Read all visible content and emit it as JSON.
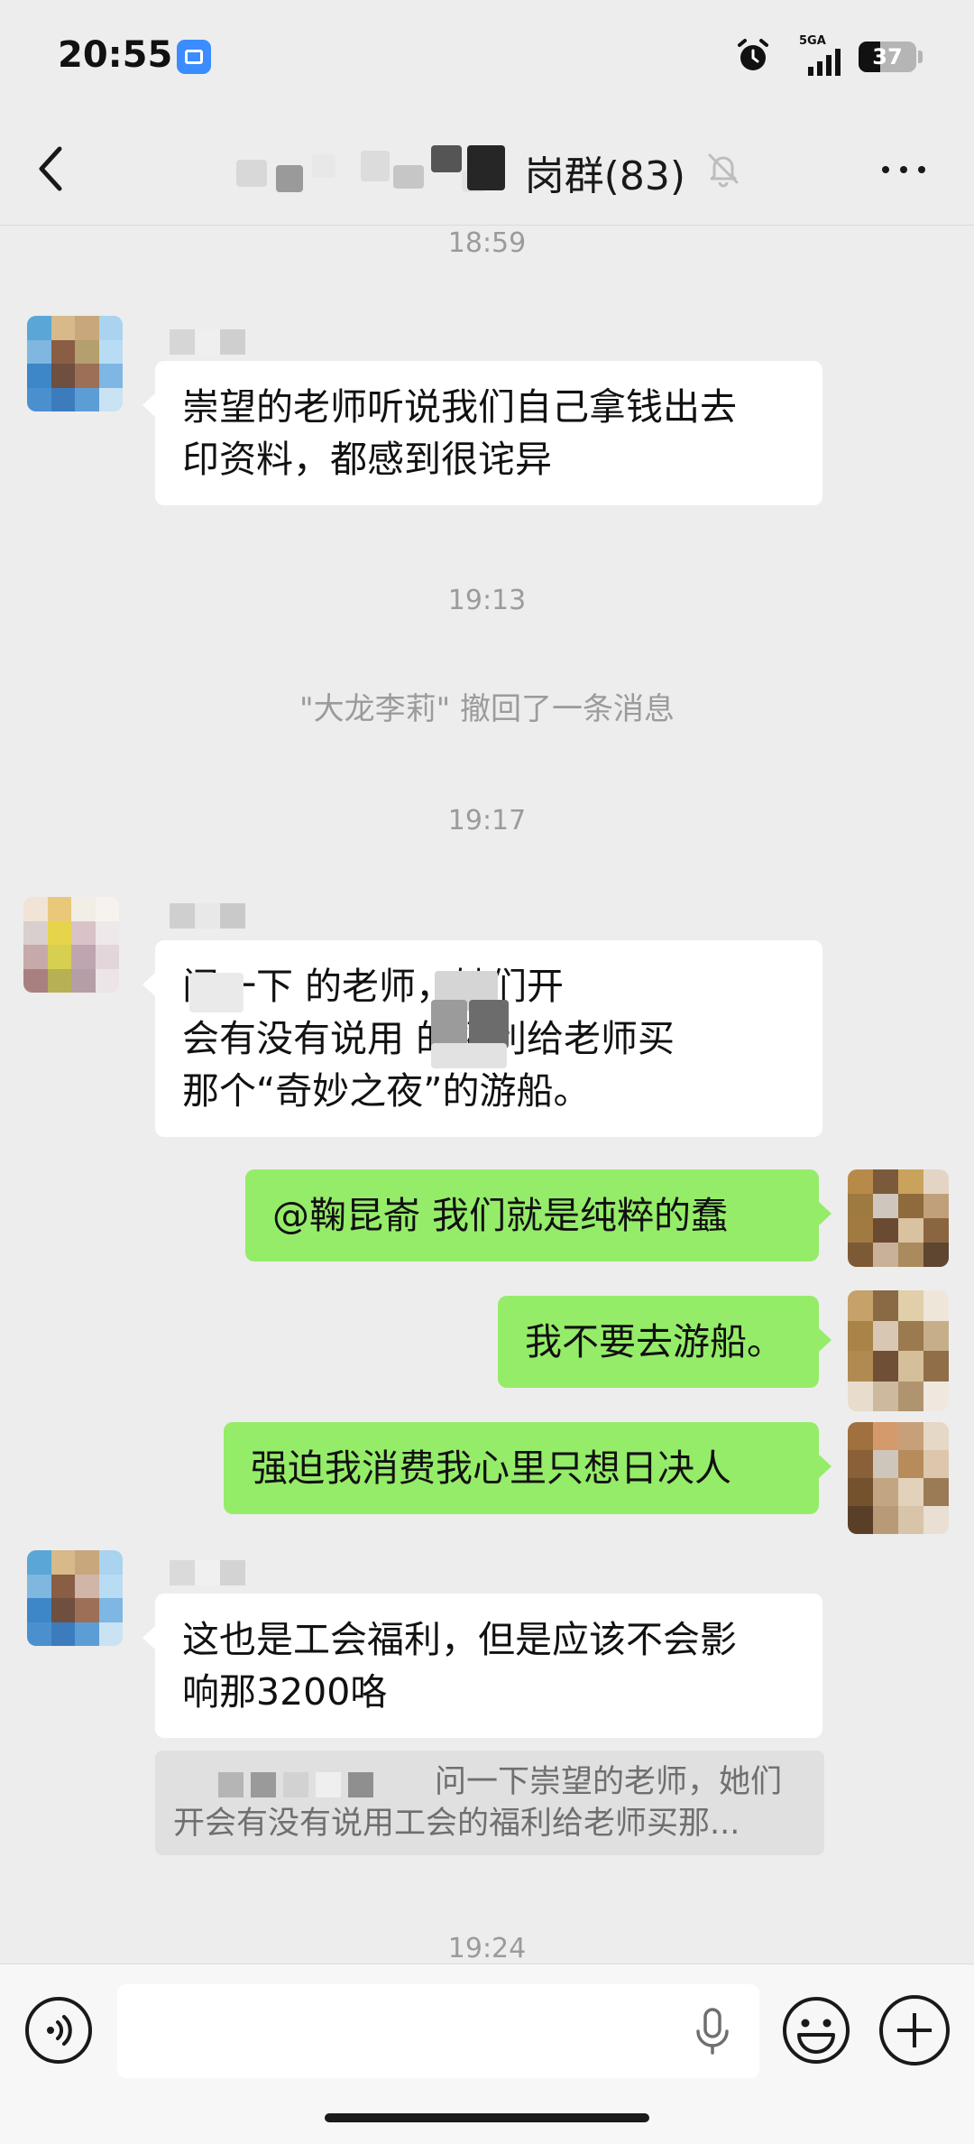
{
  "status_bar": {
    "time": "20:55",
    "network_label": "5GA",
    "battery": "37",
    "battery_level": 0.37,
    "icons": [
      "notification-app-icon",
      "alarm-icon",
      "signal-icon",
      "battery-icon"
    ]
  },
  "header": {
    "title": "岗群(83)",
    "back_icon": "chevron-left-icon",
    "mute_icon": "bell-off-icon",
    "more_icon": "more-horizontal-icon"
  },
  "messages": {
    "time_1859": "18:59",
    "msg1": "崇望的老师听说我们自己拿钱出去\n印资料，都感到很诧异",
    "time_1913": "19:13",
    "recalled": "\"大龙李莉\" 撤回了一条消息",
    "time_1917": "19:17",
    "msg2": "       问一下      的老师，她们开\n会有没有说用     的福利给老师买\n那个“奇妙之夜”的游船。",
    "msg3": "@鞠昆嵛  我们就是纯粹的蠢",
    "msg4": "我不要去游船。",
    "msg5": "强迫我消费我心里只想日决人",
    "msg6": "这也是工会福利，但是应该不会影\n响那3200咯",
    "quote_line1": "问一下崇望的老师，她们",
    "quote_line2": "开会有没有说用工会的福利给老师买那...",
    "time_1924": "19:24"
  },
  "input_bar": {
    "placeholder": "",
    "voice_icon": "voice-icon",
    "mic_icon": "microphone-icon",
    "emoji_icon": "emoji-icon",
    "plus_icon": "plus-circle-icon"
  },
  "colors": {
    "background": "#ededed",
    "incoming_bubble": "#ffffff",
    "outgoing_bubble": "#95ec69",
    "muted_text": "#9b9b9b"
  }
}
